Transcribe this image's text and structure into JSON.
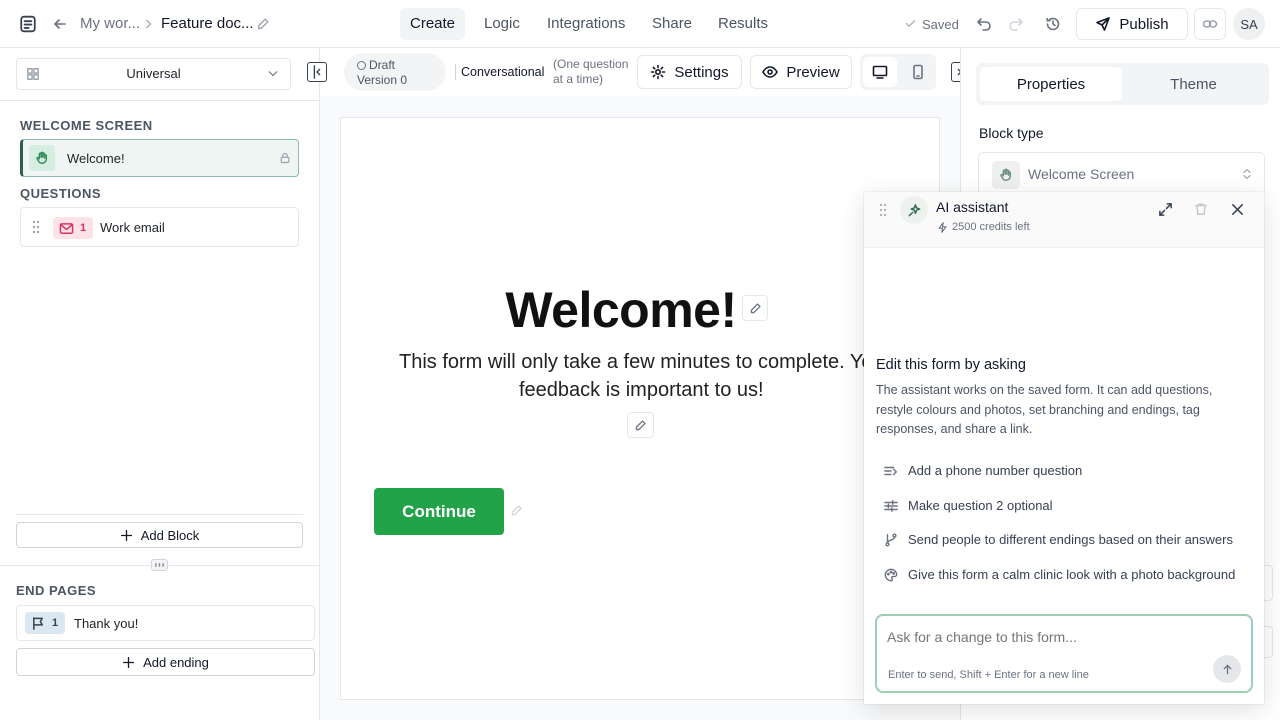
{
  "header": {
    "breadcrumb_workspace": "My wor...",
    "breadcrumb_form": "Feature doc...",
    "tabs": [
      "Create",
      "Logic",
      "Integrations",
      "Share",
      "Results"
    ],
    "saved_label": "Saved",
    "publish_label": "Publish",
    "avatar_initials": "SA"
  },
  "left": {
    "layout_select": "Universal",
    "welcome_heading": "WELCOME SCREEN",
    "welcome_item": "Welcome!",
    "questions_heading": "QUESTIONS",
    "question": {
      "number": "1",
      "label": "Work email"
    },
    "add_block_label": "Add Block",
    "end_pages_heading": "END PAGES",
    "ending": {
      "number": "1",
      "label": "Thank you!"
    },
    "add_ending_label": "Add ending"
  },
  "toolbar": {
    "draft_line1": "Draft",
    "draft_line2": "Version 0",
    "mode_label": "Conversational",
    "mode_hint_line1": "(One question",
    "mode_hint_line2": "at a time)",
    "settings_label": "Settings",
    "preview_label": "Preview"
  },
  "canvas": {
    "title": "Welcome!",
    "description_line1": "This form will only take a few minutes to complete. Your",
    "description_line2": "feedback is important to us!",
    "button_label": "Continue"
  },
  "right": {
    "tabs": [
      "Properties",
      "Theme"
    ],
    "block_type_label": "Block type",
    "block_type_value": "Welcome Screen"
  },
  "ai": {
    "title": "AI assistant",
    "credits": "2500 credits left",
    "heading": "Edit this form by asking",
    "description": "The assistant works on the saved form. It can add questions, restyle colours and photos, set branching and endings, tag responses, and share a link.",
    "suggestions": [
      "Add a phone number question",
      "Make question 2 optional",
      "Send people to different endings based on their answers",
      "Give this form a calm clinic look with a photo background"
    ],
    "input_placeholder": "Ask for a change to this form...",
    "input_hint": "Enter to send, Shift + Enter for a new line"
  },
  "colors": {
    "brand_green": "#22a34a",
    "selected_block_bg": "#eef5f2",
    "selected_block_border": "#8fb8a6",
    "email_badge_bg": "#fde3e8",
    "email_badge_fg": "#d6336c",
    "welcome_badge_bg": "#d6eee2",
    "flag_badge_bg": "#dbe8f2"
  },
  "icons": [
    "form-logo-icon",
    "back-arrow-icon",
    "chevron-right-icon",
    "pencil-icon",
    "check-icon",
    "undo-icon",
    "redo-icon",
    "history-icon",
    "send-icon",
    "link-icon",
    "grid-icon",
    "chevron-down-icon",
    "hand-icon",
    "lock-icon",
    "drag-handle-icon",
    "mail-icon",
    "plus-icon",
    "flag-icon",
    "collapse-panel-icon",
    "gear-icon",
    "eye-icon",
    "desktop-icon",
    "mobile-icon",
    "sparkle-icon",
    "bolt-icon",
    "expand-icon",
    "trash-icon",
    "close-icon",
    "text-insert-icon",
    "sliders-icon",
    "branch-icon",
    "palette-icon",
    "arrow-up-icon"
  ]
}
